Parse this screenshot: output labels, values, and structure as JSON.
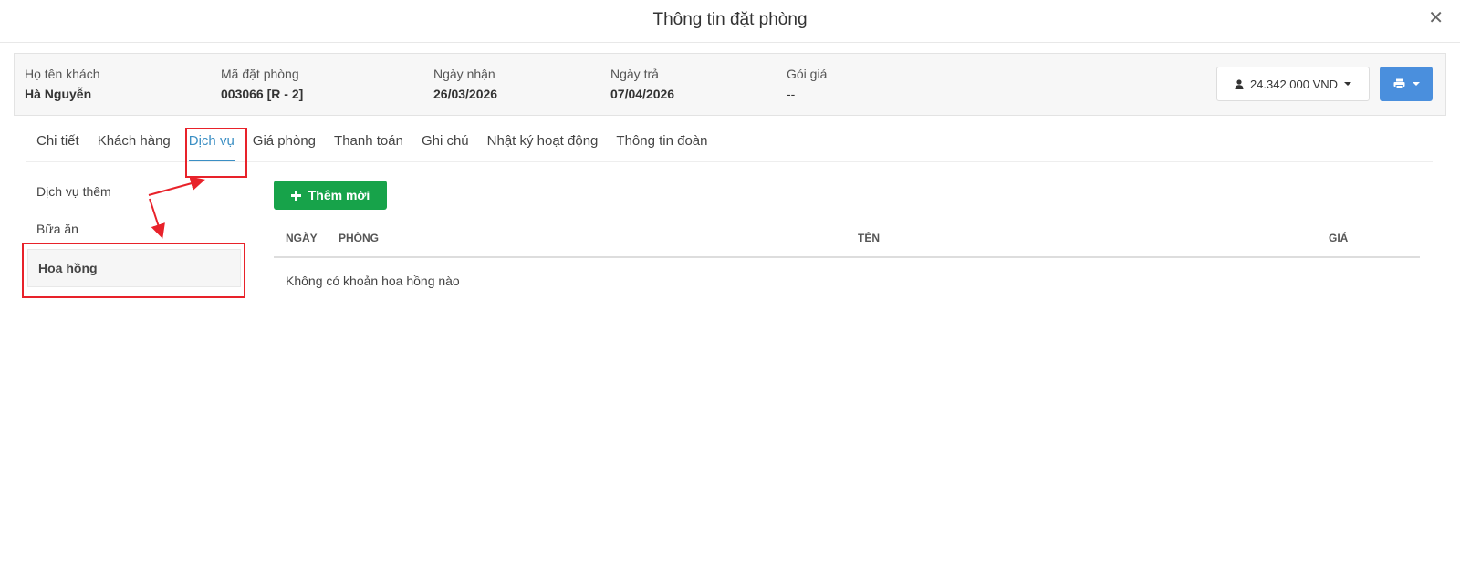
{
  "modal": {
    "title": "Thông tin đặt phòng",
    "close_glyph": "✕"
  },
  "booking": {
    "guest_label": "Họ tên khách",
    "guest_value": "Hà Nguyễn",
    "code_label": "Mã đặt phòng",
    "code_value": "003066 [R - 2]",
    "checkin_label": "Ngày nhận",
    "checkin_value": "26/03/2026",
    "checkout_label": "Ngày trả",
    "checkout_value": "07/04/2026",
    "rate_label": "Gói giá",
    "rate_value": "--"
  },
  "actions": {
    "total_amount": "24.342.000 VND",
    "user_icon": "user-icon",
    "print_icon": "print-icon"
  },
  "tabs": [
    {
      "label": "Chi tiết"
    },
    {
      "label": "Khách hàng"
    },
    {
      "label": "Dịch vụ"
    },
    {
      "label": "Giá phòng"
    },
    {
      "label": "Thanh toán"
    },
    {
      "label": "Ghi chú"
    },
    {
      "label": "Nhật ký hoạt động"
    },
    {
      "label": "Thông tin đoàn"
    }
  ],
  "active_tab": "Dịch vụ",
  "sidebar": {
    "items": [
      {
        "label": "Dịch vụ thêm"
      },
      {
        "label": "Bữa ăn"
      },
      {
        "label": "Hoa hồng"
      }
    ],
    "active": "Hoa hồng"
  },
  "content": {
    "add_button": "Thêm mới",
    "columns": {
      "date": "NGÀY",
      "room": "PHÒNG",
      "name": "TÊN",
      "price": "GIÁ"
    },
    "empty_message": "Không có khoản hoa hồng nào"
  },
  "colors": {
    "accent": "#3b8fc4",
    "primary": "#4a8fdd",
    "success": "#17a34a",
    "annotation": "#e8222a"
  }
}
